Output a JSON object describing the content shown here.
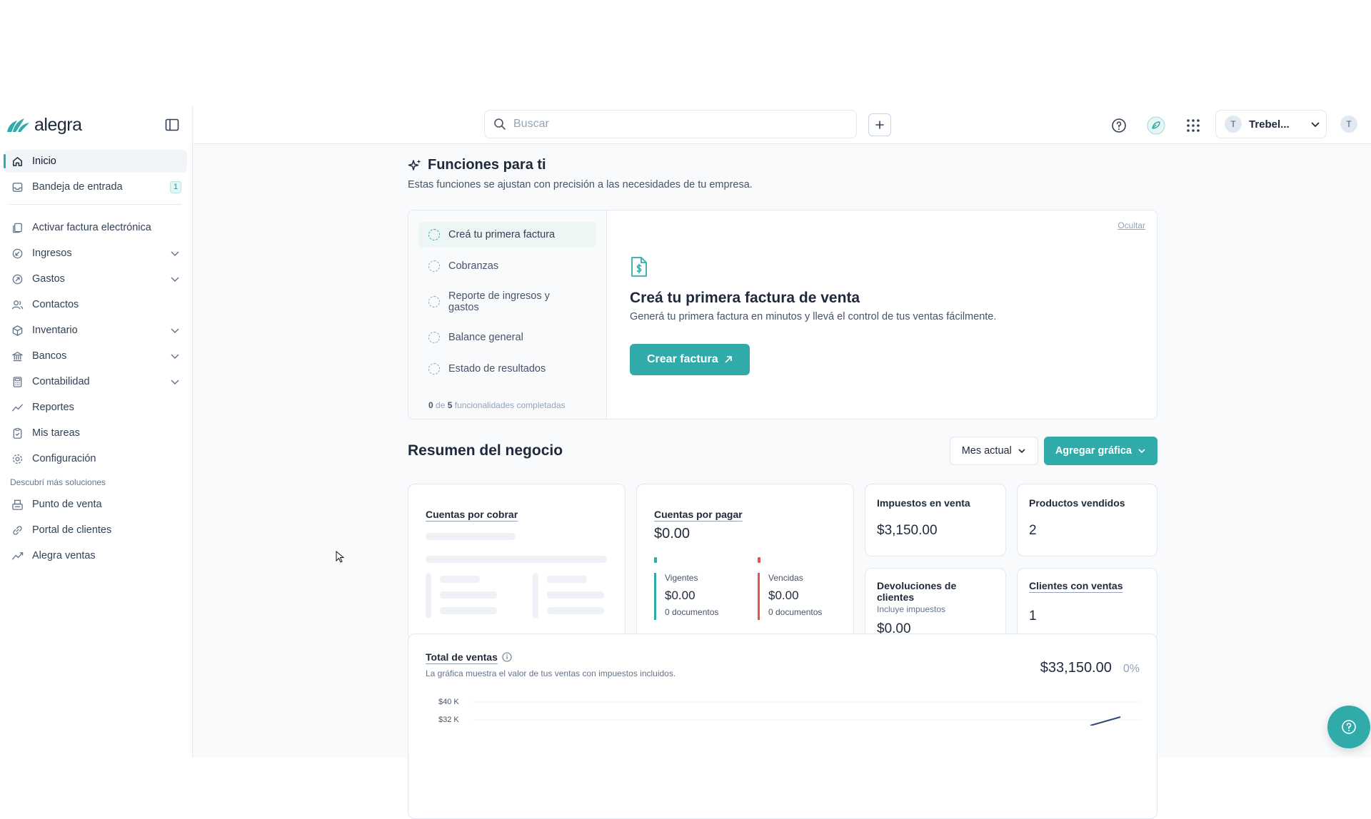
{
  "brand": {
    "name": "alegra",
    "accent": "#30aba9"
  },
  "sidebar": {
    "primary": [
      {
        "label": "Inicio",
        "icon": "home-icon",
        "active": true
      },
      {
        "label": "Bandeja de entrada",
        "icon": "inbox-icon",
        "badge": "1"
      }
    ],
    "items": [
      {
        "label": "Activar factura electrónica",
        "icon": "copy-icon"
      },
      {
        "label": "Ingresos",
        "icon": "income-icon",
        "expandable": true
      },
      {
        "label": "Gastos",
        "icon": "expense-icon",
        "expandable": true
      },
      {
        "label": "Contactos",
        "icon": "contacts-icon"
      },
      {
        "label": "Inventario",
        "icon": "box-icon",
        "expandable": true
      },
      {
        "label": "Bancos",
        "icon": "bank-icon",
        "expandable": true
      },
      {
        "label": "Contabilidad",
        "icon": "calculator-icon",
        "expandable": true
      },
      {
        "label": "Reportes",
        "icon": "trend-icon"
      },
      {
        "label": "Mis tareas",
        "icon": "clipboard-icon"
      },
      {
        "label": "Configuración",
        "icon": "gear-icon"
      }
    ],
    "section_label": "Descubrí más soluciones",
    "solutions": [
      {
        "label": "Punto de venta",
        "icon": "pos-icon"
      },
      {
        "label": "Portal de clientes",
        "icon": "link-icon"
      },
      {
        "label": "Alegra ventas",
        "icon": "trend-icon"
      }
    ]
  },
  "topbar": {
    "search_placeholder": "Buscar",
    "company_name": "Trebel...",
    "company_initial": "T",
    "user_initial": "T"
  },
  "functions": {
    "title": "Funciones para ti",
    "subtitle": "Estas funciones se ajustan con precisión a las necesidades de tu empresa.",
    "steps": [
      {
        "label": "Creá tu primera factura",
        "active": true
      },
      {
        "label": "Cobranzas"
      },
      {
        "label": "Reporte de ingresos y gastos"
      },
      {
        "label": "Balance general"
      },
      {
        "label": "Estado de resultados"
      }
    ],
    "progress_done": "0",
    "progress_of": "de",
    "progress_total": "5",
    "progress_text": "funcionalidades completadas",
    "hide_label": "Ocultar",
    "detail_title": "Creá tu primera factura de venta",
    "detail_desc": "Generá tu primera factura en minutos y llevá el control de tus ventas fácilmente.",
    "cta_label": "Crear factura"
  },
  "summary": {
    "title": "Resumen del negocio",
    "period_label": "Mes actual",
    "add_chart_label": "Agregar gráfica",
    "receivables": {
      "title": "Cuentas por cobrar"
    },
    "payables": {
      "title": "Cuentas por pagar",
      "total": "$0.00",
      "current": {
        "label": "Vigentes",
        "value": "$0.00",
        "docs": "0 documentos",
        "color": "#30aba9"
      },
      "overdue": {
        "label": "Vencidas",
        "value": "$0.00",
        "docs": "0 documentos",
        "color": "#e5534b"
      }
    },
    "sales_tax": {
      "title": "Impuestos en venta",
      "value": "$3,150.00"
    },
    "products_sold": {
      "title": "Productos vendidos",
      "value": "2"
    },
    "returns": {
      "title": "Devoluciones de clientes",
      "note": "Incluye impuestos",
      "value": "$0.00"
    },
    "clients_with_sales": {
      "title": "Clientes con ventas",
      "value": "1"
    }
  },
  "total_sales": {
    "title": "Total de ventas",
    "subtitle": "La gráfica muestra el valor de tus ventas con impuestos incluidos.",
    "amount": "$33,150.00",
    "change": "0%",
    "y_ticks": [
      "$40 K",
      "$32 K"
    ]
  }
}
